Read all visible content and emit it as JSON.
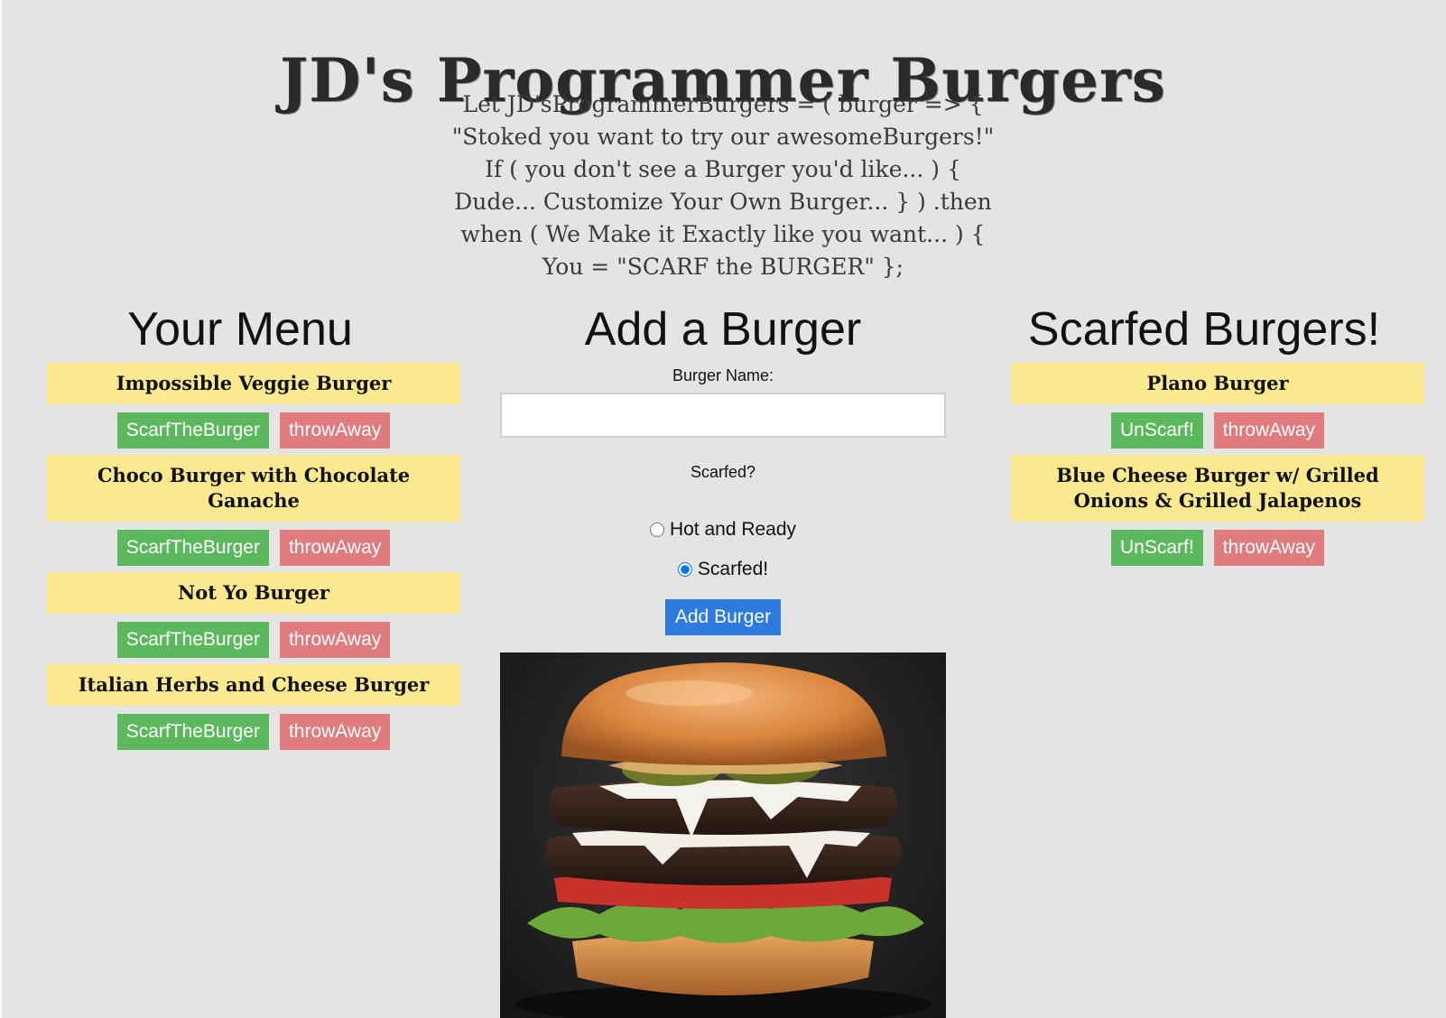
{
  "header": {
    "title": "JD's Programmer Burgers",
    "tagline": [
      "Let JD'sProgrammerBurgers = ( burger => {",
      "\"Stoked you want to try our awesomeBurgers!\"",
      "If ( you don't see a Burger you'd like... ) {",
      "Dude... Customize Your Own Burger... } ) .then",
      "when ( We Make it Exactly like you want... ) {",
      "You = \"SCARF the BURGER\" };"
    ]
  },
  "menu": {
    "heading": "Your Menu",
    "items": [
      {
        "name": "Impossible Veggie Burger",
        "primary": "ScarfTheBurger",
        "secondary": "throwAway"
      },
      {
        "name": "Choco Burger with Chocolate Ganache",
        "primary": "ScarfTheBurger",
        "secondary": "throwAway"
      },
      {
        "name": "Not Yo Burger",
        "primary": "ScarfTheBurger",
        "secondary": "throwAway"
      },
      {
        "name": "Italian Herbs and Cheese Burger",
        "primary": "ScarfTheBurger",
        "secondary": "throwAway"
      }
    ]
  },
  "add_form": {
    "heading": "Add a Burger",
    "name_label": "Burger Name:",
    "name_value": "",
    "scarfed_label": "Scarfed?",
    "options": [
      {
        "label": "Hot and Ready",
        "checked": false
      },
      {
        "label": "Scarfed!",
        "checked": true
      }
    ],
    "submit_label": "Add Burger"
  },
  "scarfed": {
    "heading": "Scarfed Burgers!",
    "items": [
      {
        "name": "Plano Burger",
        "primary": "UnScarf!",
        "secondary": "throwAway"
      },
      {
        "name": "Blue Cheese Burger w/ Grilled Onions & Grilled Jalapenos",
        "primary": "UnScarf!",
        "secondary": "throwAway"
      }
    ]
  },
  "colors": {
    "background": "#e4e4e4",
    "card": "#fde98f",
    "green_button": "#5cb85c",
    "red_button": "#e07b7e",
    "blue_button": "#2e7be0"
  }
}
